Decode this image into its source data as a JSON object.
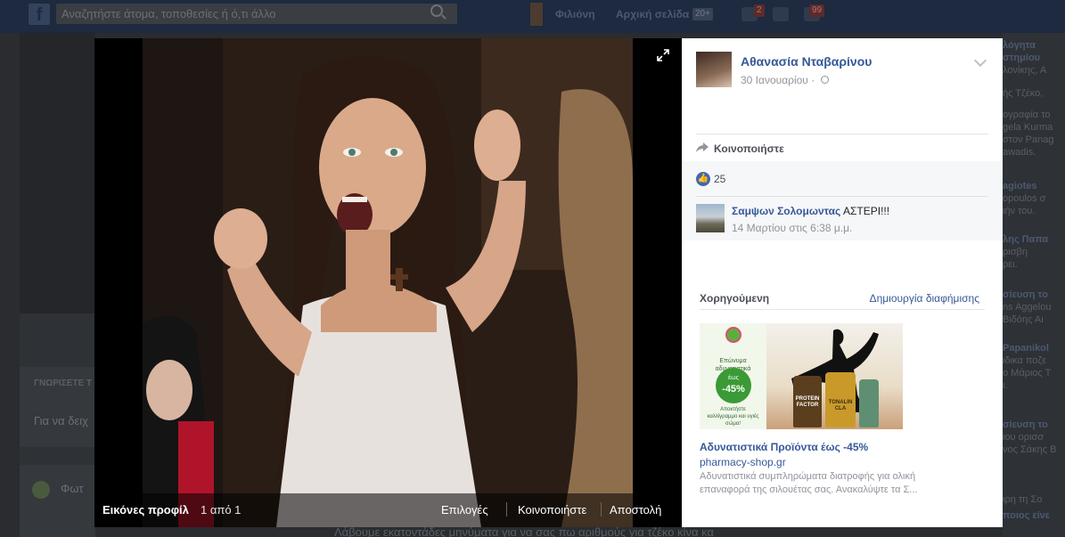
{
  "topbar": {
    "search_placeholder": "Αναζητήστε άτομα, τοποθεσίες ή ό,τι άλλο",
    "profile_name": "Φιλιόνη",
    "home_label": "Αρχική σελίδα",
    "home_badge": "20+",
    "notif_badge_1": "2",
    "notif_badge_2": "99"
  },
  "background": {
    "left_card_title": "ΓΝΩΡΙΣΕΤΕ Τ",
    "left_card_text": "Για να δειχ",
    "left_card2_text": "Φωτ",
    "bottom_text": "Λάβουμε εκατοντάδες μηνύματα για να σας πω αριθμούς για τζέκο κίνα κα",
    "right_snippets": [
      {
        "text": "λόγητα",
        "bold": true
      },
      {
        "text": "στημίου",
        "bold": true
      },
      {
        "text": "λονίκης, Α",
        "bold": false
      },
      {
        "text": "ής Τζέκο,",
        "bold": false
      },
      {
        "text": "ογραφία το",
        "bold": false
      },
      {
        "text": "gela Kurma",
        "bold": false
      },
      {
        "text": "στον Panag",
        "bold": false
      },
      {
        "text": "awadis.",
        "bold": false
      },
      {
        "text": "agiotes",
        "bold": true
      },
      {
        "text": "opoulos σ",
        "bold": false
      },
      {
        "text": "ιήν του.",
        "bold": false
      },
      {
        "text": "λης Παπα",
        "bold": true
      },
      {
        "text": "ρισβη",
        "bold": false
      },
      {
        "text": "ρει.",
        "bold": false
      },
      {
        "text": "σίευση το",
        "bold": true
      },
      {
        "text": "ns Aggelou",
        "bold": false
      },
      {
        "text": "Βιδόης Αι",
        "bold": false
      },
      {
        "text": "Papanikol",
        "bold": true
      },
      {
        "text": "ιδικα ποζε",
        "bold": false
      },
      {
        "text": "ο Μάριος Τ",
        "bold": false
      },
      {
        "text": "ι.",
        "bold": false
      },
      {
        "text": "σίευση το",
        "bold": true
      },
      {
        "text": "ιου ορισσ",
        "bold": false
      },
      {
        "text": "νος Σάκης Β",
        "bold": false
      },
      {
        "text": "ιρη τη Σο",
        "bold": false
      },
      {
        "text": "ποιος είνε",
        "bold": true
      }
    ]
  },
  "lightbox": {
    "album_name": "Εικόνες προφίλ",
    "photo_count": "1 από 1",
    "actions": [
      "Επιλογές",
      "Κοινοποιήστε",
      "Αποστολή"
    ]
  },
  "post": {
    "author": "Αθανασία Νταβαρίνου",
    "date": "30 Ιανουαρίου",
    "separator": "·",
    "share_label": "Κοινοποιήστε",
    "like_count": "25",
    "comment": {
      "author": "Σαμψων Σολομωντας",
      "text": "ΑΣΤΕΡΙ!!!",
      "time": "14 Μαρτίου στις 6:38 μ.μ."
    }
  },
  "ads": {
    "sponsored_label": "Χορηγούμενη",
    "create_ad_label": "Δημιουργία διαφήμισης",
    "ad": {
      "image_brand_text": "Επώνυμα αδυνατιστικά",
      "image_discount_top": "έως",
      "image_discount": "-45%",
      "image_small_text": "Αποκτήστε καλλίγραμμο και υγιές σώμα!",
      "image_bottle_1": "PROTEIN FACTOR",
      "image_bottle_2": "TONALIN CLA",
      "headline": "Αδυνατιστικά Προϊόντα έως -45%",
      "domain": "pharmacy-shop.gr",
      "body": "Αδυνατιστικά συμπληρώματα διατροφής για ολική επαναφορά της σιλουέτας σας. Ανακαλύψτε τα Σ..."
    }
  },
  "colors": {
    "link_blue": "#365899",
    "like_blue": "#4267b2",
    "topbar": "#1d2a3f"
  }
}
